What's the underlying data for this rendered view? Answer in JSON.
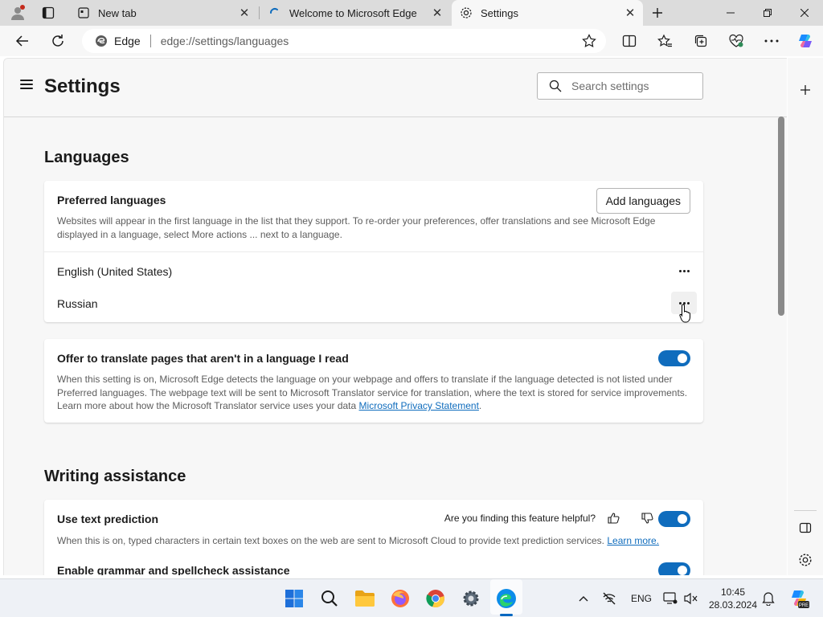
{
  "browser": {
    "tabs": [
      {
        "title": "New tab"
      },
      {
        "title": "Welcome to Microsoft Edge"
      },
      {
        "title": "Settings"
      }
    ],
    "address_bar": {
      "site_label": "Edge",
      "url": "edge://settings/languages"
    }
  },
  "settings": {
    "page_title": "Settings",
    "search_placeholder": "Search settings",
    "languages_section": {
      "title": "Languages",
      "preferred": {
        "title": "Preferred languages",
        "add_button": "Add languages",
        "description": "Websites will appear in the first language in the list that they support. To re-order your preferences, offer translations and see Microsoft Edge displayed in a language, select More actions ... next to a language.",
        "items": [
          {
            "name": "English (United States)"
          },
          {
            "name": "Russian"
          }
        ]
      },
      "translate": {
        "title": "Offer to translate pages that aren't in a language I read",
        "description": "When this setting is on, Microsoft Edge detects the language on your webpage and offers to translate if the language detected is not listed under Preferred languages. The webpage text will be sent to Microsoft Translator service for translation, where the text is stored for service improvements. Learn more about how the Microsoft Translator service uses your data",
        "link": "Microsoft Privacy Statement",
        "trailing": ".",
        "enabled": true
      }
    },
    "writing_section": {
      "title": "Writing assistance",
      "text_prediction": {
        "title": "Use text prediction",
        "feedback_question": "Are you finding this feature helpful?",
        "description": "When this is on, typed characters in certain text boxes on the web are sent to Microsoft Cloud to provide text prediction services.",
        "link": "Learn more.",
        "enabled": true
      },
      "grammar": {
        "title": "Enable grammar and spellcheck assistance",
        "enabled": true
      }
    }
  },
  "taskbar": {
    "language": "ENG",
    "time": "10:45",
    "date": "28.03.2024",
    "badge": "PRE"
  },
  "colors": {
    "accent": "#0f6cbd",
    "content_bg": "#f7f7f7",
    "tabstrip_bg": "#dcdcdc"
  }
}
